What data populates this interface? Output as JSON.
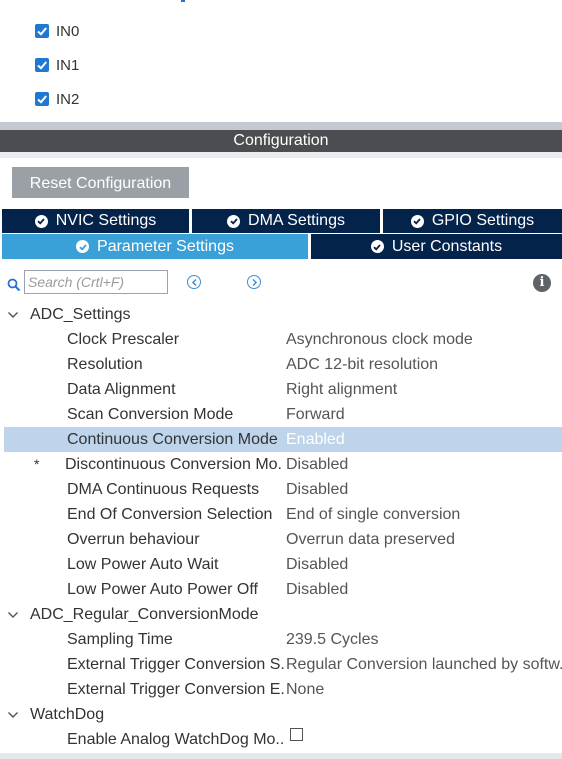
{
  "channels": [
    {
      "label": "IN0",
      "checked": true
    },
    {
      "label": "IN1",
      "checked": true
    },
    {
      "label": "IN2",
      "checked": true
    }
  ],
  "config_title": "Configuration",
  "reset_label": "Reset Configuration",
  "tabs": {
    "nvic": "NVIC Settings",
    "dma": "DMA Settings",
    "gpio": "GPIO Settings",
    "parameter": "Parameter Settings",
    "user_constants": "User Constants",
    "active": "Parameter Settings"
  },
  "search": {
    "placeholder": "Search (Crtl+F)"
  },
  "groups": {
    "adc_settings": {
      "label": "ADC_Settings",
      "rows": [
        {
          "key": "Clock Prescaler",
          "value": "Asynchronous clock mode"
        },
        {
          "key": "Resolution",
          "value": "ADC 12-bit resolution"
        },
        {
          "key": "Data Alignment",
          "value": "Right alignment"
        },
        {
          "key": "Scan Conversion Mode",
          "value": "Forward"
        },
        {
          "key": "Continuous Conversion Mode",
          "value": "Enabled"
        },
        {
          "key": "Discontinuous Conversion Mo...",
          "value": "Disabled",
          "star": "*"
        },
        {
          "key": "DMA Continuous Requests",
          "value": "Disabled"
        },
        {
          "key": "End Of Conversion Selection",
          "value": "End of single conversion"
        },
        {
          "key": "Overrun behaviour",
          "value": "Overrun data preserved"
        },
        {
          "key": "Low Power Auto Wait",
          "value": "Disabled"
        },
        {
          "key": "Low Power Auto Power Off",
          "value": "Disabled"
        }
      ]
    },
    "regular": {
      "label": "ADC_Regular_ConversionMode",
      "rows": [
        {
          "key": "Sampling Time",
          "value": "239.5 Cycles"
        },
        {
          "key": "External Trigger Conversion S...",
          "value": "Regular Conversion launched by softw..."
        },
        {
          "key": "External Trigger Conversion E...",
          "value": "None"
        }
      ]
    },
    "watchdog": {
      "label": "WatchDog",
      "rows": [
        {
          "key": "Enable Analog WatchDog Mo...",
          "value_checkbox": false
        }
      ]
    }
  },
  "colors": {
    "tab_dark": "#03234b",
    "tab_active": "#3aa0d8",
    "selected_row": "#bdd4ea",
    "checkbox_blue": "#1f78d1"
  }
}
